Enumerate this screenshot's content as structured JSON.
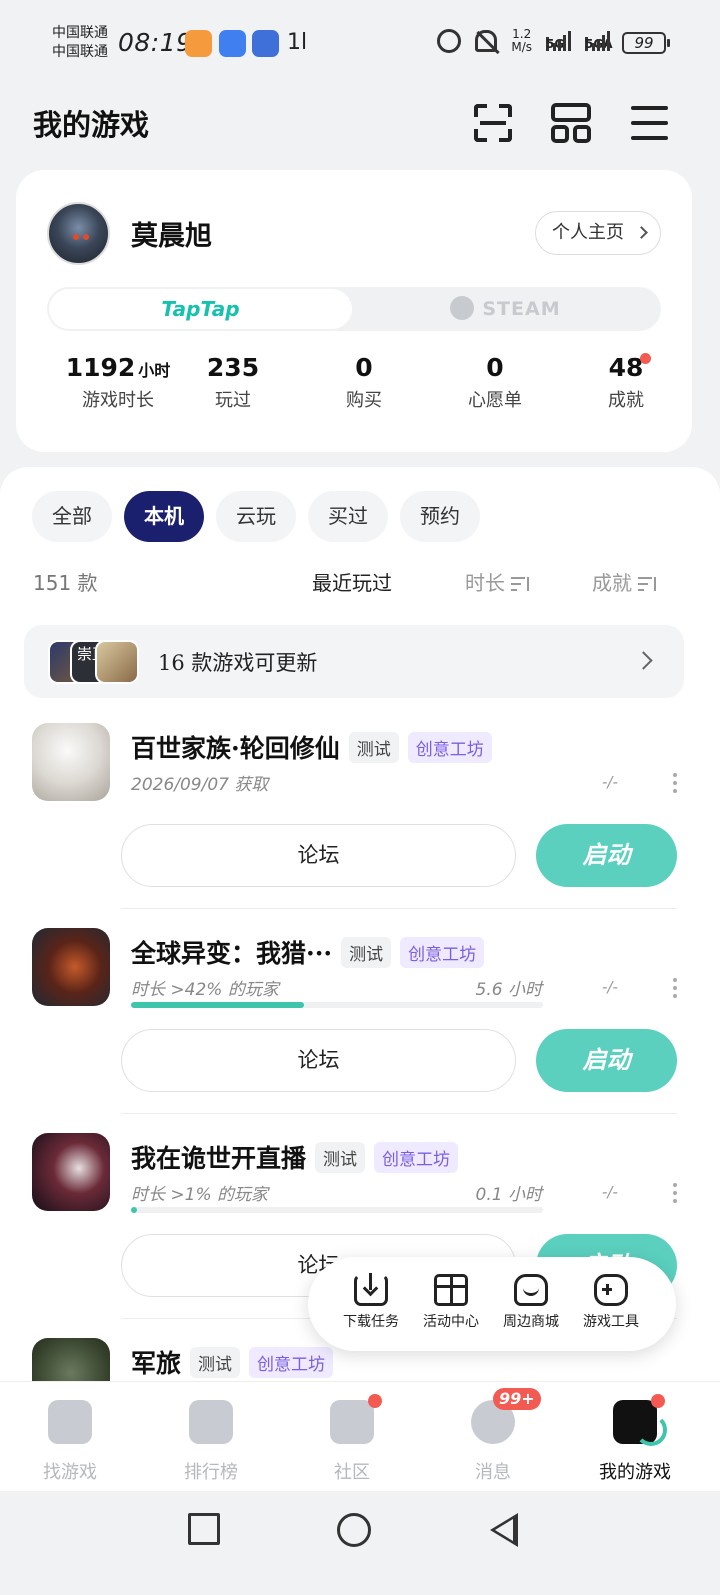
{
  "status_bar": {
    "carrier_1": "中国联通",
    "carrier_2": "中国联通",
    "time": "08:19",
    "misc": "1l",
    "net_speed_value": "1.2",
    "net_speed_unit": "M/s",
    "net_1": "5G",
    "net_2": "5GA",
    "battery": "99"
  },
  "header": {
    "title": "我的游戏",
    "icons": [
      "scan-icon",
      "layout-icon",
      "menu-icon"
    ]
  },
  "profile": {
    "username": "莫晨旭",
    "home_button": "个人主页",
    "platforms": {
      "taptap": "TapTap",
      "steam": "STEAM"
    },
    "stats": [
      {
        "value": "1192",
        "unit": "小时",
        "label": "游戏时长"
      },
      {
        "value": "235",
        "unit": "",
        "label": "玩过"
      },
      {
        "value": "0",
        "unit": "",
        "label": "购买"
      },
      {
        "value": "0",
        "unit": "",
        "label": "心愿单"
      },
      {
        "value": "48",
        "unit": "",
        "label": "成就"
      }
    ]
  },
  "filters": [
    "全部",
    "本机",
    "云玩",
    "买过",
    "预约"
  ],
  "active_filter": "本机",
  "sort": {
    "count": "151 款",
    "recent": "最近玩过",
    "duration": "时长",
    "achievement": "成就"
  },
  "update_banner": {
    "thumb_text": "崇直",
    "text": "16 款游戏可更新"
  },
  "games": [
    {
      "title": "百世家族·轮回修仙",
      "tag_test": "测试",
      "tag_workshop": "创意工坊",
      "subtitle": "2026/09/07 获取",
      "hours": "",
      "progress": null,
      "dash": "-/-",
      "forum": "论坛",
      "launch": "启动"
    },
    {
      "title": "全球异变：我猎···",
      "tag_test": "测试",
      "tag_workshop": "创意工坊",
      "subtitle": "时长 >42% 的玩家",
      "hours": "5.6 小时",
      "progress": 0.42,
      "dash": "-/-",
      "forum": "论坛",
      "launch": "启动"
    },
    {
      "title": "我在诡世开直播",
      "tag_test": "测试",
      "tag_workshop": "创意工坊",
      "subtitle": "时长 >1% 的玩家",
      "hours": "0.1 小时",
      "progress": 0.01,
      "dash": "-/-",
      "forum": "论坛",
      "launch": "启动"
    },
    {
      "title": "军旅",
      "tag_test": "测试",
      "tag_workshop": "创意工坊"
    }
  ],
  "float_bar": [
    {
      "label": "下载任务",
      "icon": "download-icon"
    },
    {
      "label": "活动中心",
      "icon": "gift-icon"
    },
    {
      "label": "周边商城",
      "icon": "shop-icon"
    },
    {
      "label": "游戏工具",
      "icon": "gamepad-icon"
    }
  ],
  "bottom_nav": [
    {
      "label": "找游戏",
      "icon": "find-game-icon"
    },
    {
      "label": "排行榜",
      "icon": "ranking-icon"
    },
    {
      "label": "社区",
      "icon": "community-icon"
    },
    {
      "label": "消息",
      "icon": "message-icon",
      "badge": "99+"
    },
    {
      "label": "我的游戏",
      "icon": "my-games-icon"
    }
  ],
  "colors": {
    "accent": "#5bd0bf",
    "active_chip": "#1a1f6e",
    "workshop_tag": "#7b5fe0",
    "alert": "#f25a52"
  }
}
